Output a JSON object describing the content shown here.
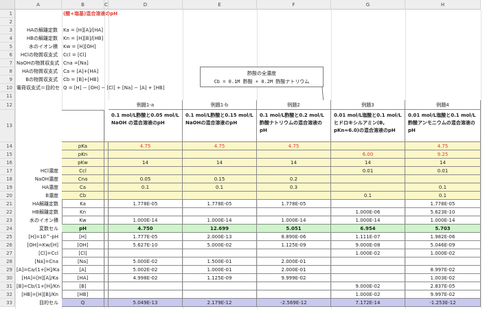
{
  "columns": [
    "A",
    "B",
    "C",
    "D",
    "E",
    "F",
    "G",
    "H"
  ],
  "title": "(酸+塩基)混合溶液のpH",
  "defs": [
    {
      "row": "3",
      "label": "HAの解離定数",
      "formula": "Ka = [H][A]/[HA]"
    },
    {
      "row": "4",
      "label": "HBの解離定数",
      "formula": "Kn = [H][B]/[HB]"
    },
    {
      "row": "5",
      "label": "水のイオン積",
      "formula": "Kw = [H][OH]"
    },
    {
      "row": "6",
      "label": "HClの物質収支式",
      "formula": "Ccl = [Cl]"
    },
    {
      "row": "7",
      "label": "NaOHの物質収支式",
      "formula": "Cna =[Na]"
    },
    {
      "row": "8",
      "label": "HAの物質収支式",
      "formula": "Ca = [A]+[HA]"
    },
    {
      "row": "9",
      "label": "Bの物質収支式",
      "formula": "Cb = [B]+[HB]"
    },
    {
      "row": "10",
      "label": "電荷収支式＝目的セル",
      "formula": "Q = [H] − [OH] − [Cl] + [Na] − [A] + [HB]"
    }
  ],
  "callout": {
    "line1": "酢酸の全濃度",
    "line2": "Cb = 0.1M 酢酸 + 0.2M 酢酸ナトリウム"
  },
  "case_headers": [
    "例題1-a",
    "例題1-b",
    "例題2",
    "例題3",
    "例題4"
  ],
  "case_desc": [
    "0.1 mol/L酢酸と0.05 mol/L NaOH の混合溶液のpH",
    "0.1 mol/L酢酸と0.15 mol/L NaOHの混合溶液のpH",
    "0.1 mol/L酢酸と0.2 mol/L酢酸ナトリウムの混合溶液のpH",
    "0.01 mol/L塩酸と0.1 mol/Lヒドロキシルアミン(B, pKn=6.0)の混合溶液のpH",
    "0.01 mol/L塩酸と0.1 mol/L酢酸アンモニウムの混合溶液のpH"
  ],
  "rows": [
    {
      "n": "14",
      "a": "",
      "b": "pKa",
      "style": "yellow",
      "vals": [
        "4.75",
        "4.75",
        "4.75",
        "",
        "4.75"
      ],
      "red": true
    },
    {
      "n": "15",
      "a": "",
      "b": "pKn",
      "style": "yellow",
      "vals": [
        "",
        "",
        "",
        "6.00",
        "9.25"
      ],
      "red": true
    },
    {
      "n": "16",
      "a": "",
      "b": "pKw",
      "style": "yellow",
      "vals": [
        "14",
        "14",
        "14",
        "14",
        "14"
      ]
    },
    {
      "n": "17",
      "a": "HCl濃度",
      "b": "Ccl",
      "style": "yellow",
      "vals": [
        "",
        "",
        "",
        "0.01",
        "0.01"
      ]
    },
    {
      "n": "18",
      "a": "NaOH濃度",
      "b": "Cna",
      "style": "yellow",
      "vals": [
        "0.05",
        "0.15",
        "0.2",
        "",
        ""
      ]
    },
    {
      "n": "19",
      "a": "HA濃度",
      "b": "Ca",
      "style": "yellow",
      "vals": [
        "0.1",
        "0.1",
        "0.3",
        "",
        "0.1"
      ]
    },
    {
      "n": "20",
      "a": "B濃度",
      "b": "Cb",
      "style": "yellow",
      "vals": [
        "",
        "",
        "",
        "0.1",
        "0.1"
      ]
    },
    {
      "n": "21",
      "a": "HA解離定数",
      "b": "Ka",
      "style": "",
      "vals": [
        "1.778E-05",
        "1.778E-05",
        "1.778E-05",
        "",
        "1.778E-05"
      ]
    },
    {
      "n": "22",
      "a": "HB解離定数",
      "b": "Kn",
      "style": "",
      "vals": [
        "",
        "",
        "",
        "1.000E-06",
        "5.623E-10"
      ]
    },
    {
      "n": "23",
      "a": "水のイオン積",
      "b": "Kw",
      "style": "",
      "vals": [
        "1.000E-14",
        "1.000E-14",
        "1.000E-14",
        "1.000E-14",
        "1.000E-14"
      ]
    },
    {
      "n": "24",
      "a": "変数セル",
      "b": "pH",
      "style": "green",
      "vals": [
        "4.750",
        "12.699",
        "5.051",
        "6.954",
        "5.703"
      ],
      "bold": true
    },
    {
      "n": "25",
      "a": "[H]=10^-pH",
      "b": "[H]",
      "style": "",
      "vals": [
        "1.777E-05",
        "2.000E-13",
        "8.890E-06",
        "1.111E-07",
        "1.982E-06"
      ]
    },
    {
      "n": "26",
      "a": "[OH]=Kw/[H]",
      "b": "[OH]",
      "style": "",
      "vals": [
        "5.627E-10",
        "5.000E-02",
        "1.125E-09",
        "9.000E-08",
        "5.046E-09"
      ]
    },
    {
      "n": "27",
      "a": "[Cl]=Ccl",
      "b": "[Cl]",
      "style": "",
      "vals": [
        "",
        "",
        "",
        "1.000E-02",
        "1.000E-02"
      ]
    },
    {
      "n": "28",
      "a": "[Na]=Cna",
      "b": "[Na]",
      "style": "",
      "vals": [
        "5.000E-02",
        "1.500E-01",
        "2.000E-01",
        "",
        ""
      ]
    },
    {
      "n": "29",
      "a": "[A]=Ca/(1+[H]/Ka)",
      "b": "[A]",
      "style": "",
      "vals": [
        "5.002E-02",
        "1.000E-01",
        "2.000E-01",
        "",
        "8.997E-02"
      ]
    },
    {
      "n": "30",
      "a": "[HA]=[H][A]/Ka",
      "b": "[HA]",
      "style": "",
      "vals": [
        "4.998E-02",
        "1.125E-09",
        "9.999E-02",
        "",
        "1.003E-02"
      ]
    },
    {
      "n": "31",
      "a": "[B]=Cb/(1+[H]/Kn)",
      "b": "[B]",
      "style": "",
      "vals": [
        "",
        "",
        "",
        "9.000E-02",
        "2.837E-05"
      ]
    },
    {
      "n": "32",
      "a": "[HB]=[H][B]/Kn",
      "b": "[HB]",
      "style": "",
      "vals": [
        "",
        "",
        "",
        "1.000E-02",
        "9.997E-02"
      ]
    },
    {
      "n": "33",
      "a": "目的セル",
      "b": "Q",
      "style": "purple",
      "vals": [
        "5.049E-13",
        "2.179E-12",
        "-2.569E-12",
        "7.172E-14",
        "-1.253E-12"
      ]
    }
  ]
}
